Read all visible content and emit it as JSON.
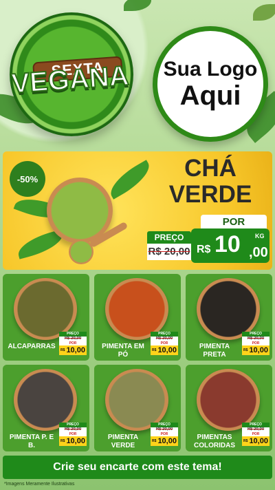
{
  "colors": {
    "brand_green": "#1f8a1a",
    "accent_yellow": "#f7c72a"
  },
  "header": {
    "badge_line1": "SEXTA",
    "badge_line2": "VEGANA",
    "logo_line1": "Sua Logo",
    "logo_line2": "Aqui"
  },
  "featured": {
    "discount": "-50%",
    "title_line1": "CHÁ",
    "title_line2": "VERDE",
    "preco_label": "PREÇO",
    "old_price": "R$ 20,00",
    "por_label": "POR",
    "currency": "R$",
    "price_int": "10",
    "price_cents": ",00",
    "unit": "KG"
  },
  "products": [
    {
      "name": "ALCAPARRAS",
      "preco_label": "PREÇO",
      "old_price": "R$ 20,00",
      "por_label": "POR",
      "currency": "R$",
      "price": "10,00",
      "bowl_color": "#6b6a2f"
    },
    {
      "name": "PIMENTA EM PÓ",
      "preco_label": "PREÇO",
      "old_price": "R$ 20,00",
      "por_label": "POR",
      "currency": "R$",
      "price": "10,00",
      "bowl_color": "#c8501c"
    },
    {
      "name": "PIMENTA PRETA",
      "preco_label": "PREÇO",
      "old_price": "R$ 20,00",
      "por_label": "POR",
      "currency": "R$",
      "price": "10,00",
      "bowl_color": "#2a2622"
    },
    {
      "name": "PIMENTA P. E B.",
      "preco_label": "PREÇO",
      "old_price": "R$ 20,00",
      "por_label": "POR",
      "currency": "R$",
      "price": "10,00",
      "bowl_color": "#4a4440"
    },
    {
      "name": "PIMENTA VERDE",
      "preco_label": "PREÇO",
      "old_price": "R$ 20,00",
      "por_label": "POR",
      "currency": "R$",
      "price": "10,00",
      "bowl_color": "#8a8a52"
    },
    {
      "name": "PIMENTAS COLORIDAS",
      "preco_label": "PREÇO",
      "old_price": "R$ 20,00",
      "por_label": "POR",
      "currency": "R$",
      "price": "10,00",
      "bowl_color": "#8a3a2e"
    }
  ],
  "cta": "Crie seu encarte com este tema!",
  "disclaimer": "*Imagens Meramente Ilustrativas"
}
